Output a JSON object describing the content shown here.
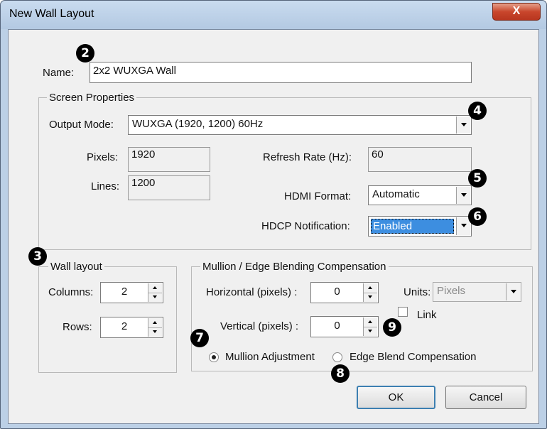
{
  "window": {
    "title": "New Wall Layout",
    "close_glyph": "X"
  },
  "name": {
    "label": "Name:",
    "value": "2x2 WUXGA Wall"
  },
  "screen_properties": {
    "legend": "Screen Properties",
    "output_mode": {
      "label": "Output Mode:",
      "value": "WUXGA (1920, 1200) 60Hz"
    },
    "pixels": {
      "label": "Pixels:",
      "value": "1920"
    },
    "lines": {
      "label": "Lines:",
      "value": "1200"
    },
    "refresh_rate": {
      "label": "Refresh Rate (Hz):",
      "value": "60"
    },
    "hdmi_format": {
      "label": "HDMI Format:",
      "value": "Automatic"
    },
    "hdcp_notification": {
      "label": "HDCP Notification:",
      "value": "Enabled"
    }
  },
  "wall_layout": {
    "legend": "Wall layout",
    "columns": {
      "label": "Columns:",
      "value": "2"
    },
    "rows": {
      "label": "Rows:",
      "value": "2"
    }
  },
  "mullion": {
    "legend": "Mullion / Edge Blending Compensation",
    "horizontal": {
      "label": "Horizontal (pixels) :",
      "value": "0"
    },
    "vertical": {
      "label": "Vertical (pixels) :",
      "value": "0"
    },
    "units": {
      "label": "Units:",
      "value": "Pixels"
    },
    "link": {
      "label": "Link",
      "checked": false
    },
    "mode_options": [
      {
        "label": "Mullion Adjustment",
        "selected": true
      },
      {
        "label": "Edge Blend Compensation",
        "selected": false
      }
    ]
  },
  "buttons": {
    "ok": "OK",
    "cancel": "Cancel"
  },
  "callouts": [
    "2",
    "3",
    "4",
    "5",
    "6",
    "7",
    "8",
    "9"
  ]
}
